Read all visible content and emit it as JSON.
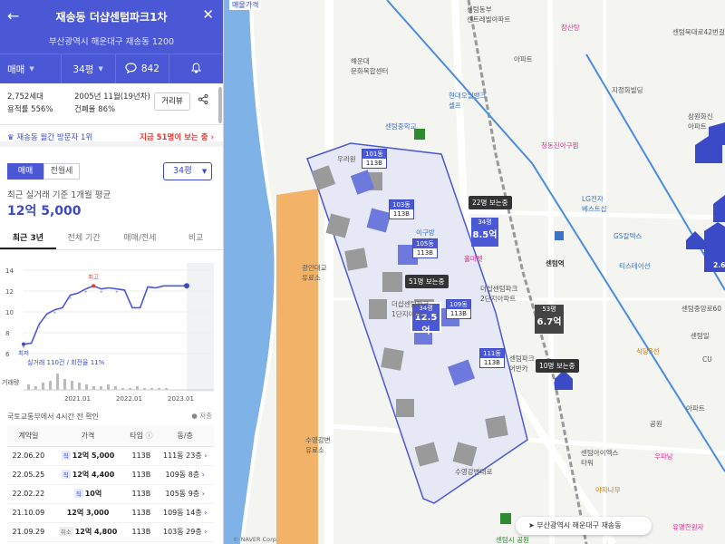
{
  "header": {
    "title": "재송동 더샵센텀파크1차",
    "address": "부산광역시 해운대구 재송동 1200",
    "deal_type": "매매",
    "size": "34평",
    "comment_count": "842"
  },
  "info": {
    "households": "2,752세대",
    "far": "용적률 556%",
    "built": "2005년 11월(19년차)",
    "coverage": "건폐율 86%",
    "distance_button": "거리뷰"
  },
  "rank": {
    "left": "재송동 월간 방문자 1위",
    "right": "지금 51명이 보는 중"
  },
  "segment": {
    "sale": "매매",
    "rent": "전월세"
  },
  "size_select": "34평",
  "average": {
    "label": "최근 실거래 기준 1개월 평균",
    "value": "12억 5,000"
  },
  "tabs": [
    "최근 3년",
    "전체 기간",
    "매매/전세",
    "비교"
  ],
  "chart_data": {
    "type": "line",
    "yticks": [
      "14",
      "12",
      "10",
      "8",
      "6"
    ],
    "ylim": [
      6,
      14
    ],
    "xticks": [
      "2021.01",
      "2022.01",
      "2023.01"
    ],
    "series": [
      {
        "x": [
          0,
          2,
          4,
          6,
          8,
          10,
          12,
          14,
          16,
          18,
          20,
          22,
          24,
          26,
          28,
          30,
          32,
          34,
          36,
          38,
          40,
          42
        ],
        "values": [
          6.9,
          7.0,
          8.8,
          9.8,
          10.2,
          10.4,
          11.6,
          11.8,
          12.2,
          12.5,
          12.2,
          12.3,
          12.2,
          12.1,
          10.4,
          10.4,
          12.4,
          12.3,
          12.5,
          12.5,
          12.5,
          12.5
        ]
      }
    ],
    "annotations": {
      "high": "최고",
      "low": "최저",
      "volume_label": "거래량"
    },
    "note": "실거래 110건 / 회전율 11%"
  },
  "source": {
    "left": "국토교통부에서 4시간 전 확인",
    "right": "저층"
  },
  "deals": {
    "headers": [
      "계약일",
      "가격",
      "타입",
      "동/층"
    ],
    "rows": [
      {
        "date": "22.06.20",
        "tag": "직",
        "price": "12억 5,000",
        "type": "113B",
        "unit": "111동 23층"
      },
      {
        "date": "22.05.25",
        "tag": "직",
        "price": "12억 4,400",
        "type": "113B",
        "unit": "109동 8층"
      },
      {
        "date": "22.02.22",
        "tag": "직",
        "price": "10억",
        "type": "113B",
        "unit": "105동 9층"
      },
      {
        "date": "21.10.09",
        "tag": "",
        "price": "12억 3,000",
        "type": "113B",
        "unit": "109동 14층"
      },
      {
        "date": "21.09.29",
        "tag": "취소",
        "price": "12억 4,800",
        "type": "113B",
        "unit": "103동 29층"
      }
    ]
  },
  "map": {
    "top_tag": "매물가격",
    "price_boxes": [
      {
        "dong": "101동",
        "type": "113B"
      },
      {
        "dong": "103동",
        "type": "113B"
      },
      {
        "dong": "105동",
        "type": "113B"
      },
      {
        "dong": "109동",
        "type": "113B"
      },
      {
        "dong": "111동",
        "type": "113B"
      }
    ],
    "viewers": [
      "22명 보는중",
      "51명 보는중",
      "10명 보는중"
    ],
    "badges": [
      {
        "size": "34평",
        "price": "8.5억"
      },
      {
        "size": "34평",
        "price": "12.5억"
      },
      {
        "size": "53평",
        "price": "6.7억"
      }
    ],
    "labels": {
      "haeundae_center": "해운대\n문화복합센터",
      "centum_station": "센텀역",
      "centum_park_1": "더샵센텀파크\n1단지아파트",
      "centum_park_2": "더샵센텀파크\n2단지아파트",
      "gwangan_parking": "광안대교\n유료소",
      "suyeong_parking": "수영강변\n유료소",
      "lg_center": "LG전자\n베스트샵",
      "gs_apt": "GS칼텍스",
      "tis": "티스테이션",
      "suyeong_riverside": "수영강변대로",
      "centum_middle": "센텀중학교",
      "market": "현대오일뱅크\n셀프",
      "drug": "청동진아구찜",
      "centum_jungang": "센텀동부\n센트레빌아파트",
      "jangsan": "장산탕",
      "jisang": "지정화빌딩",
      "samwon": "삼원화신\n아파트",
      "centum_lake": "센텀파크\n어반카",
      "sikdang": "식당3선",
      "gym": "센텀아이엑스\n타워",
      "park": "공원",
      "fuel": "우파낭",
      "mart": "아파트",
      "gakga": "유명한원자",
      "road_42": "센텀북대로42번길",
      "road_60": "센텀중앙로60",
      "bank": "야자나무",
      "sign_wooriban": "우리원",
      "sign_igubang": "이구방",
      "sign_market": "홀마켓",
      "sign_apt": "아파트",
      "cu": "CU",
      "centum_il": "센텀일",
      "centum_pleas": "센텀시 공원",
      "two_wheel": "2.6"
    },
    "address_pill": "부산광역시 해운대구 재송동",
    "credit": "© NAVER Corp."
  }
}
